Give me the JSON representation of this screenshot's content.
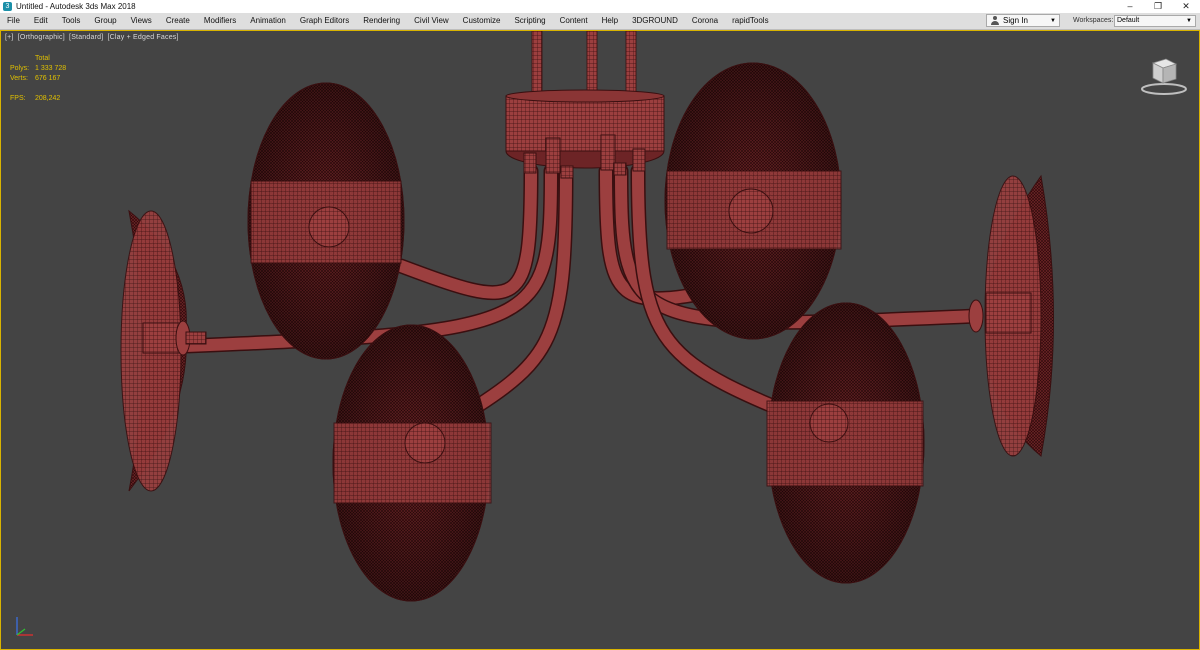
{
  "window": {
    "title": "Untitled - Autodesk 3ds Max 2018",
    "controls": [
      "–",
      "❐",
      "✕"
    ]
  },
  "menu": {
    "items": [
      "File",
      "Edit",
      "Tools",
      "Group",
      "Views",
      "Create",
      "Modifiers",
      "Animation",
      "Graph Editors",
      "Rendering",
      "Civil View",
      "Customize",
      "Scripting",
      "Content",
      "Help",
      "3DGROUND",
      "Corona",
      "rapidTools"
    ]
  },
  "account": {
    "sign_in_label": "Sign In"
  },
  "workspace": {
    "label": "Workspaces:",
    "value": "Default"
  },
  "viewport": {
    "labels": [
      "[+]",
      "[Orthographic]",
      "[Standard]",
      "[Clay + Edged Faces]"
    ],
    "stats": {
      "header": "Total",
      "polys_label": "Polys:",
      "polys_value": "1 333 728",
      "verts_label": "Verts:",
      "verts_value": "676 167",
      "fps_label": "FPS:",
      "fps_value": "208,242"
    },
    "viewcube_icon": "viewcube-icon",
    "axis_icon": "axis-tripod-icon"
  },
  "colors": {
    "viewport_bg": "#444444",
    "mesh_fill": "#9c3f3f",
    "mesh_wire": "#3a0f10",
    "stats_text": "#e0c000"
  }
}
